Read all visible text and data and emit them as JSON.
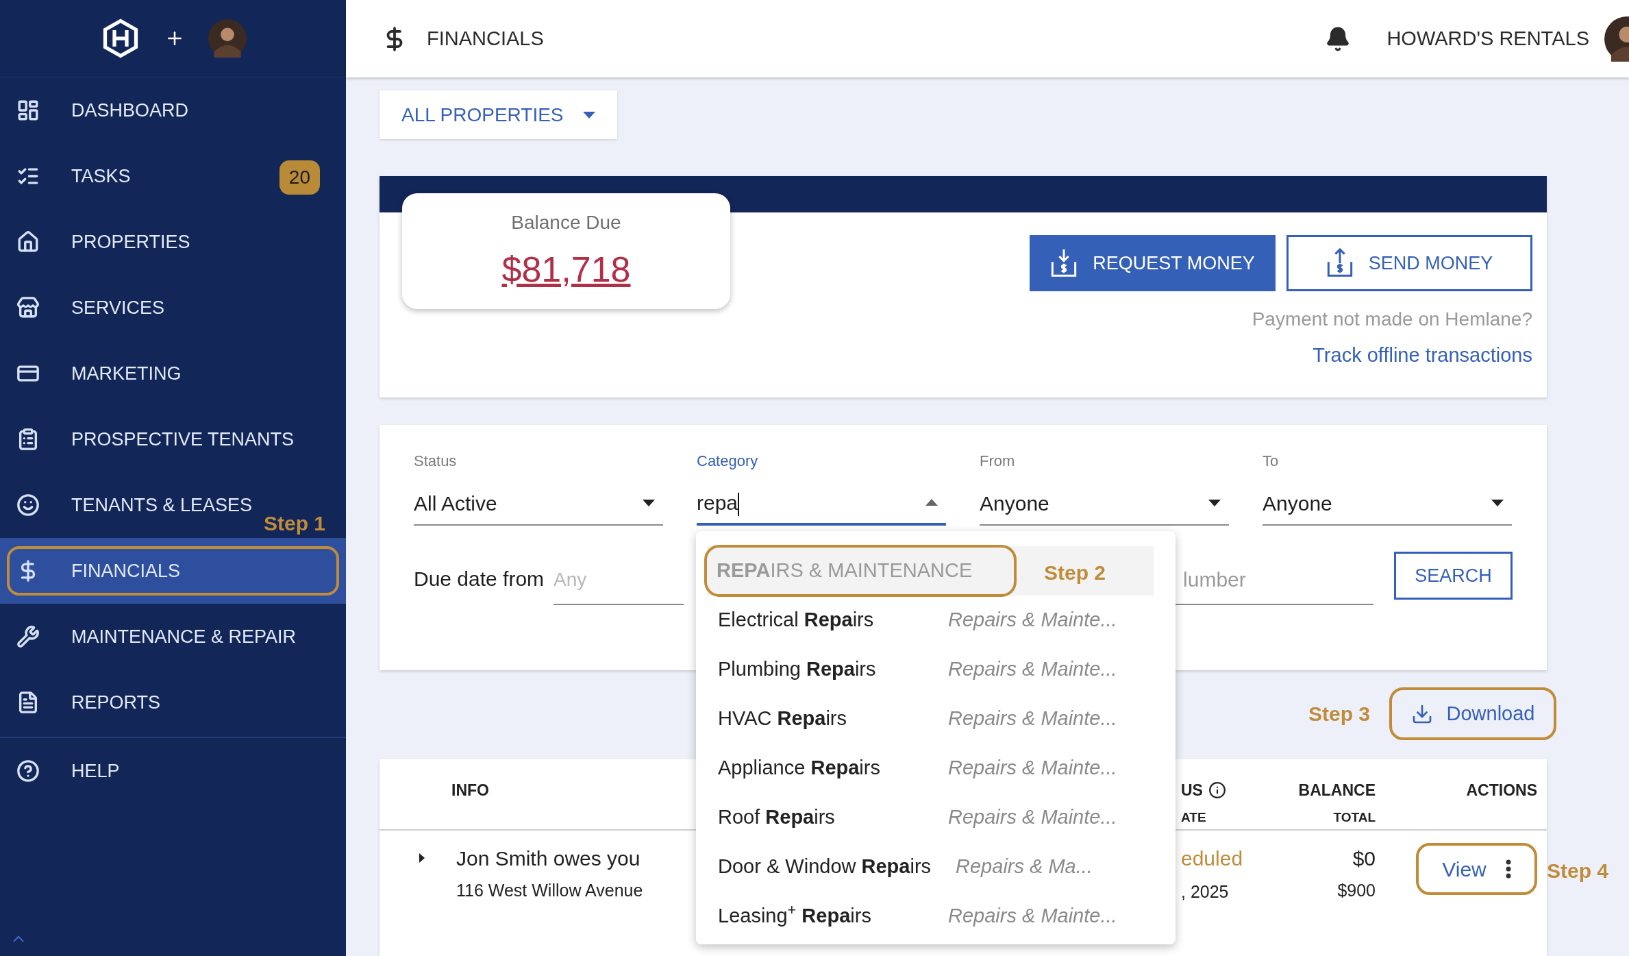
{
  "sidebar": {
    "items": [
      {
        "label": "DASHBOARD",
        "selected": false,
        "highlighted": false
      },
      {
        "label": "TASKS",
        "badge": "20",
        "selected": false,
        "highlighted": false
      },
      {
        "label": "PROPERTIES",
        "selected": false,
        "highlighted": false
      },
      {
        "label": "SERVICES",
        "selected": false,
        "highlighted": false
      },
      {
        "label": "MARKETING",
        "selected": false,
        "highlighted": false
      },
      {
        "label": "PROSPECTIVE TENANTS",
        "selected": false,
        "highlighted": false
      },
      {
        "label": "TENANTS & LEASES",
        "annotation": "Step 1",
        "selected": false,
        "highlighted": false
      },
      {
        "label": "FINANCIALS",
        "selected": true,
        "highlighted": true
      },
      {
        "label": "MAINTENANCE & REPAIR",
        "selected": false,
        "highlighted": false
      },
      {
        "label": "REPORTS",
        "selected": false,
        "highlighted": false
      }
    ],
    "footer_items": [
      {
        "label": "HELP",
        "selected": false,
        "highlighted": false
      }
    ]
  },
  "header": {
    "title": "FINANCIALS",
    "account": "HOWARD'S RENTALS"
  },
  "property_filter": {
    "label": "ALL PROPERTIES"
  },
  "balance": {
    "label": "Balance Due",
    "amount": "$81,718"
  },
  "money_buttons": [
    {
      "label": "REQUEST MONEY",
      "kind": "request"
    },
    {
      "label": "SEND MONEY",
      "kind": "send"
    }
  ],
  "offline_note": "Payment not made on Hemlane?",
  "offline_link": "Track offline transactions",
  "filters": [
    {
      "label": "Status",
      "value": "All Active",
      "focused": false
    },
    {
      "label": "Category",
      "value": "repa",
      "focused": true
    },
    {
      "label": "From",
      "value": "Anyone",
      "focused": false
    },
    {
      "label": "To",
      "value": "Anyone",
      "focused": false
    }
  ],
  "due_date": {
    "label": "Due date from",
    "placeholder": "Any"
  },
  "number_field": {
    "placeholder": "lumber"
  },
  "search_button": "SEARCH",
  "dropdown": {
    "options": [
      {
        "label": "**REPA**IRS & MAINTENANCE",
        "kind": "group",
        "highlighted": true,
        "annotation": "Step 2"
      },
      {
        "label": "Electrical **Repa**irs",
        "category": "Repairs & Mainte...",
        "kind": "option",
        "highlighted": false
      },
      {
        "label": "Plumbing **Repa**irs",
        "category": "Repairs & Mainte...",
        "kind": "option",
        "highlighted": false
      },
      {
        "label": "HVAC **Repa**irs",
        "category": "Repairs & Mainte...",
        "kind": "option",
        "highlighted": false
      },
      {
        "label": "Appliance **Repa**irs",
        "category": "Repairs & Mainte...",
        "kind": "option",
        "highlighted": false
      },
      {
        "label": "Roof **Repa**irs",
        "category": "Repairs & Mainte...",
        "kind": "option",
        "highlighted": false
      },
      {
        "label": "Door & Window **Repa**irs",
        "category": "Repairs & Ma...",
        "kind": "option",
        "highlighted": false
      },
      {
        "label": "Leasing$^{+}$ **Repa**irs",
        "category": "Repairs & Mainte...",
        "kind": "option",
        "highlighted": false
      }
    ]
  },
  "download": {
    "label": "Download",
    "annotation": "Step 3"
  },
  "table": {
    "columns": [
      {
        "label": "INFO"
      },
      {
        "label": "US",
        "sublabel": "ATE",
        "info_icon": true
      },
      {
        "label": "BALANCE",
        "sublabel": "TOTAL"
      },
      {
        "label": "ACTIONS"
      }
    ],
    "rows": [
      {
        "expanded": false,
        "title": "Jon Smith owes you",
        "address": "116 West Willow Avenue",
        "status": "eduled",
        "date": ", 2025",
        "balance": "$0",
        "total": "$900",
        "action": "View",
        "annotation": "Step 4"
      }
    ]
  }
}
